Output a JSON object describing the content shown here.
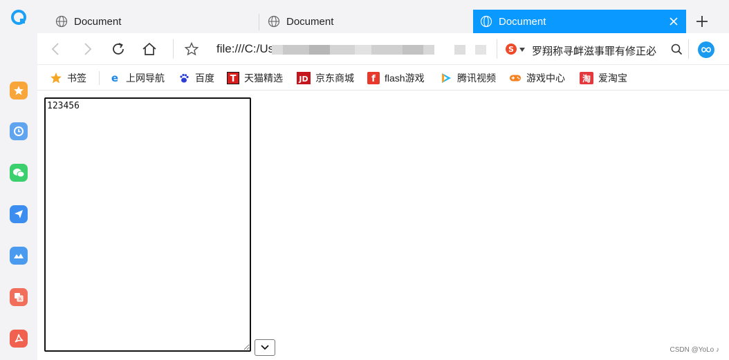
{
  "tabs": [
    {
      "label": "Document",
      "active": false
    },
    {
      "label": "Document",
      "active": false
    },
    {
      "label": "Document",
      "active": true
    }
  ],
  "address": {
    "url": "file:///C:/Us",
    "search_text": "罗翔称寻衅滋事罪有修正必"
  },
  "bookmarks": [
    {
      "label": "书签",
      "icon": "star-icon"
    },
    {
      "label": "上网导航",
      "icon": "ie-icon"
    },
    {
      "label": "百度",
      "icon": "baidu-paw-icon"
    },
    {
      "label": "天猫精选",
      "icon": "tmall-icon"
    },
    {
      "label": "京东商城",
      "icon": "jd-icon"
    },
    {
      "label": "flash游戏",
      "icon": "flash-icon"
    },
    {
      "label": "腾讯视频",
      "icon": "tencent-video-icon"
    },
    {
      "label": "游戏中心",
      "icon": "gamepad-icon"
    },
    {
      "label": "爱淘宝",
      "icon": "taobao-icon"
    }
  ],
  "page": {
    "textarea_value": "123456",
    "watermark": "CSDN @YoLo ♪"
  },
  "colors": {
    "accent": "#0a99ff",
    "sidebar_bg": "#f3f3f5"
  }
}
